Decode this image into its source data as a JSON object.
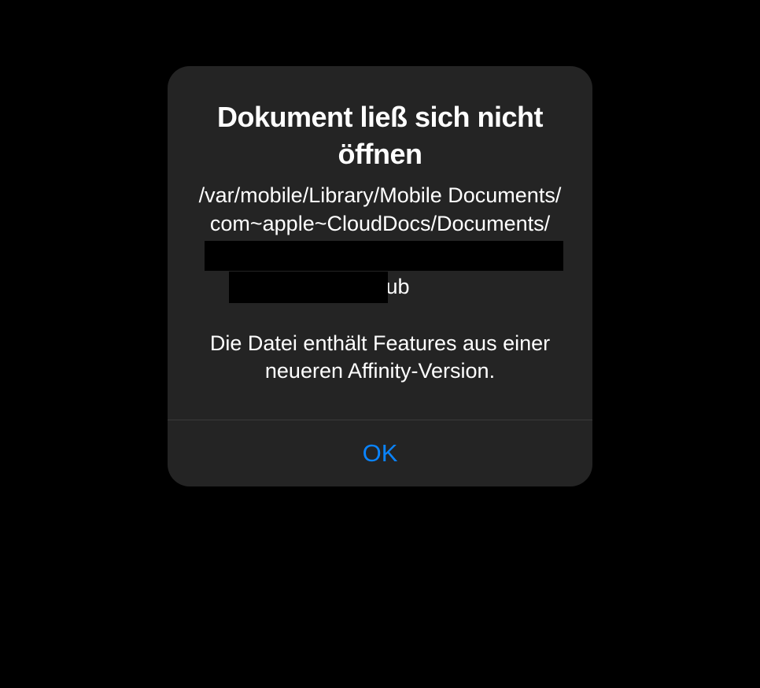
{
  "alert": {
    "title": "Dokument ließ sich nicht öffnen",
    "path_line_1": "/var/mobile/Library/Mobile Documents/",
    "path_line_2": "com~apple~CloudDocs/Documents/",
    "file_extension": ".afpub",
    "message": "Die Datei enthält Features aus einer neueren Affinity-Version.",
    "ok_button": "OK"
  }
}
